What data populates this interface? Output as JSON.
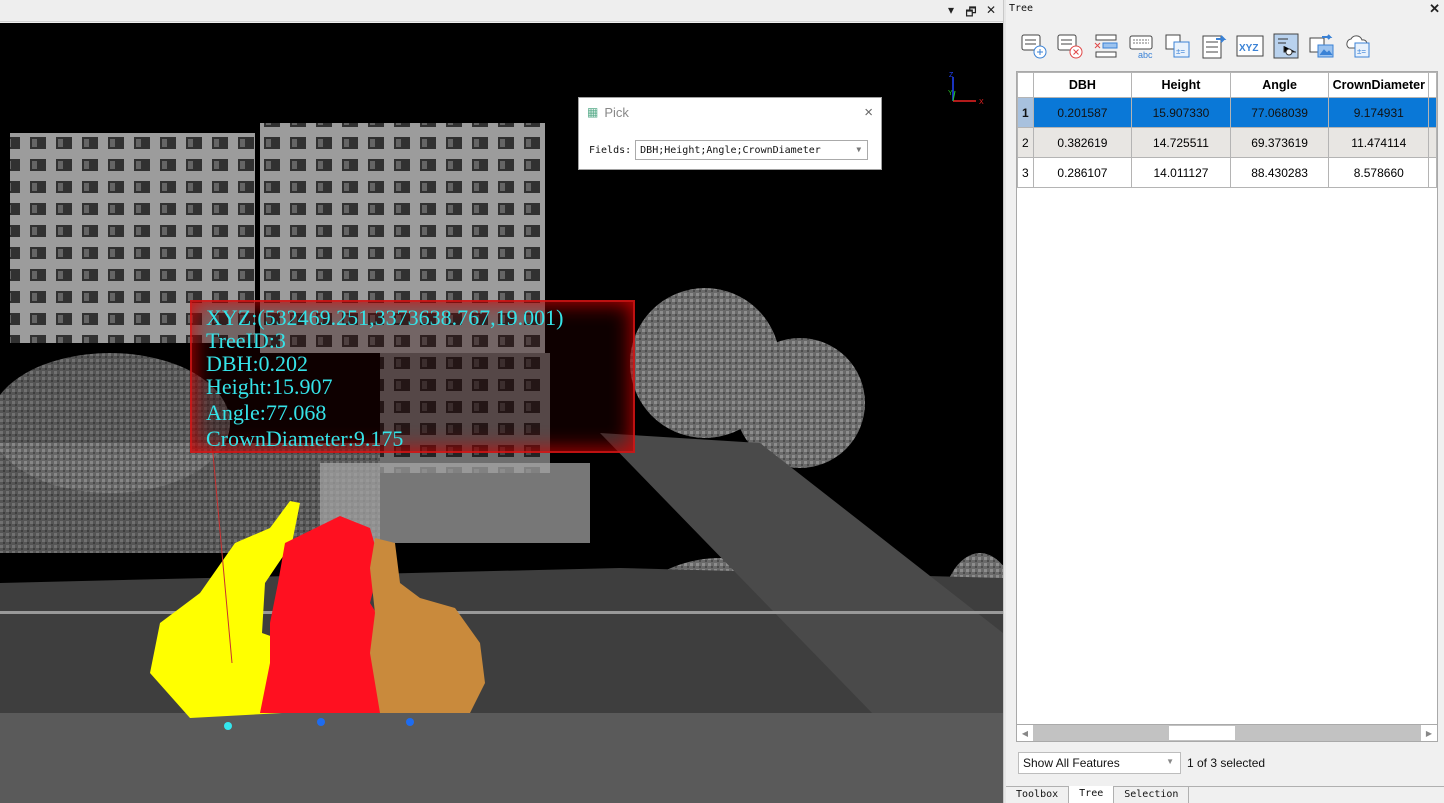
{
  "viewport": {
    "header_controls": [
      "▾",
      "🗗",
      "✕"
    ],
    "axis_labels": {
      "x": "X",
      "y": "Y",
      "z": "Z"
    },
    "tree_colors": [
      "#ffff00",
      "#ff1020",
      "#c98a3c"
    ],
    "marker_colors": [
      "#33e6ee",
      "#1e6cf0",
      "#1e6cf0"
    ]
  },
  "pick_dialog": {
    "title": "Pick",
    "fields_label": "Fields:",
    "fields_value": "DBH;Height;Angle;CrownDiameter",
    "close_icon": "×"
  },
  "info_box": {
    "lines": [
      "XYZ:(532469.251,3373638.767,19.001)",
      "TreeID:3",
      "DBH:0.202",
      "Height:15.907",
      "Angle:77.068",
      "CrownDiameter:9.175"
    ],
    "text_color": "#35e3e8",
    "border_color": "#dc1414"
  },
  "panel": {
    "title": "Tree",
    "pin_icon": "pin-icon",
    "close_icon": "close-icon",
    "toolbar": [
      {
        "name": "add-field",
        "icon": "add-field-icon"
      },
      {
        "name": "delete-field",
        "icon": "delete-field-icon"
      },
      {
        "name": "delete-record",
        "icon": "delete-record-icon"
      },
      {
        "name": "rename-field",
        "icon": "keyboard-abc-icon"
      },
      {
        "name": "field-calculator",
        "icon": "calculator-icon"
      },
      {
        "name": "export-table",
        "icon": "export-table-icon"
      },
      {
        "name": "xyz",
        "icon": "xyz-icon",
        "label": "XYZ"
      },
      {
        "name": "zoom-to-selected",
        "icon": "zoom-selected-icon"
      },
      {
        "name": "export-image",
        "icon": "export-image-icon"
      },
      {
        "name": "cloud-calculator",
        "icon": "cloud-calculator-icon"
      }
    ],
    "table": {
      "columns": [
        "DBH",
        "Height",
        "Angle",
        "CrownDiameter"
      ],
      "rows": [
        {
          "id": "1",
          "cells": [
            "0.201587",
            "15.907330",
            "77.068039",
            "9.174931"
          ],
          "selected": true
        },
        {
          "id": "2",
          "cells": [
            "0.382619",
            "14.725511",
            "69.373619",
            "11.474114"
          ],
          "selected": false
        },
        {
          "id": "3",
          "cells": [
            "0.286107",
            "14.011127",
            "88.430283",
            "8.578660"
          ],
          "selected": false
        }
      ],
      "selection_color": "#0a78d7"
    },
    "filter": "Show All Features",
    "selection_status": "1 of 3 selected",
    "tabs": [
      "Toolbox",
      "Tree",
      "Selection"
    ],
    "active_tab": "Tree"
  }
}
